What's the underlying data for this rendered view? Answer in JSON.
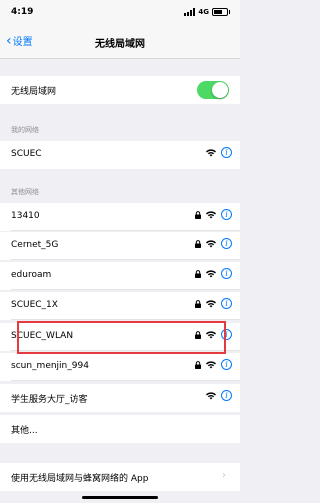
{
  "status": {
    "time": "4:19",
    "network": "4G"
  },
  "nav": {
    "back_label": "设置",
    "title": "无线局域网"
  },
  "wifi_toggle": {
    "label": "无线局域网",
    "on": true
  },
  "my_networks": {
    "header": "我的网络",
    "items": [
      {
        "name": "SCUEC",
        "locked": false
      }
    ]
  },
  "other_networks": {
    "header": "其他网络",
    "items": [
      {
        "name": "13410",
        "locked": true
      },
      {
        "name": "Cernet_5G",
        "locked": true
      },
      {
        "name": "eduroam",
        "locked": true
      },
      {
        "name": "SCUEC_1X",
        "locked": true
      },
      {
        "name": "SCUEC_WLAN",
        "locked": true
      },
      {
        "name": "scun_menjin_994",
        "locked": true
      },
      {
        "name": "学生服务大厅_访客",
        "locked": false
      }
    ],
    "other_label": "其他..."
  },
  "footer": {
    "label": "使用无线局域网与蜂窝网络的 App"
  },
  "colors": {
    "accent": "#007aff",
    "toggle_on": "#4cd964",
    "highlight": "#e53a40"
  }
}
